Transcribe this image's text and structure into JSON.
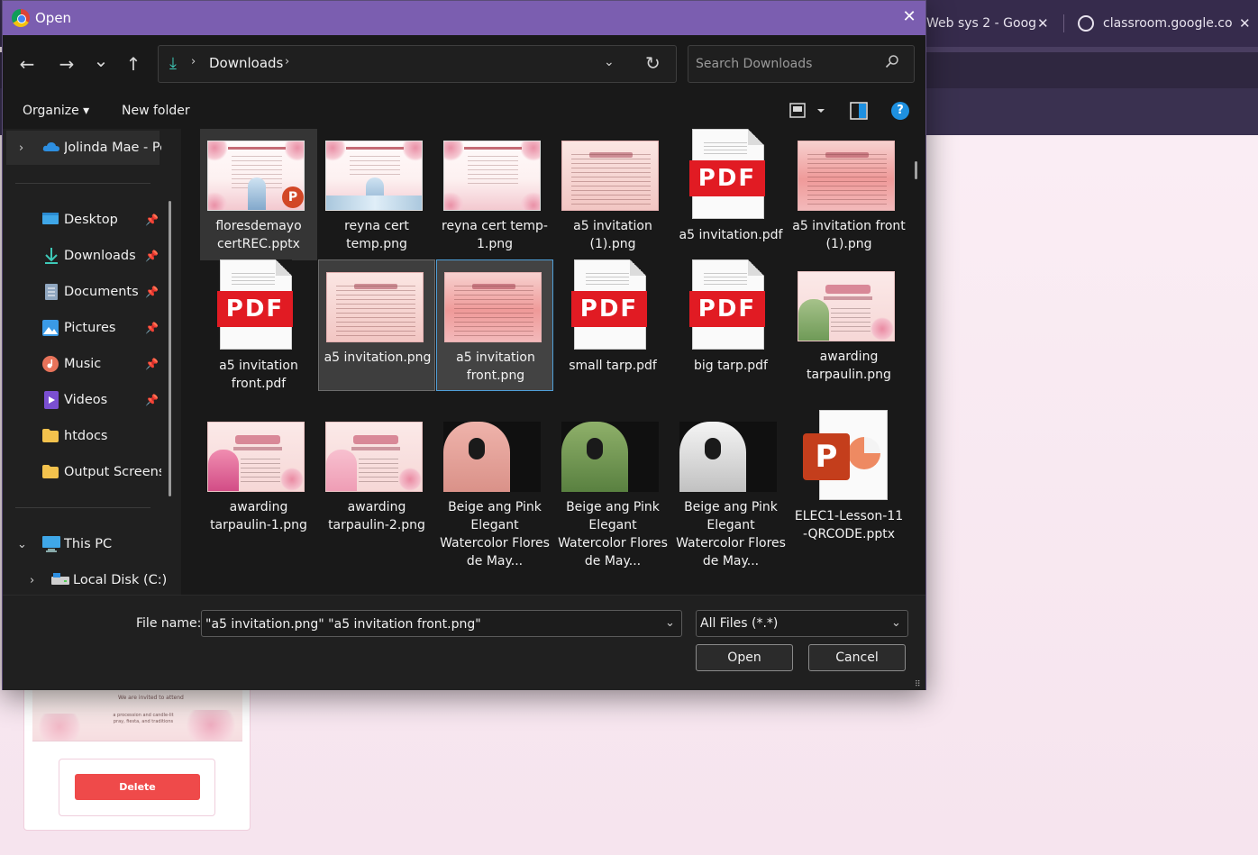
{
  "browser": {
    "tabs": [
      {
        "title": "Web sys 2 - Goog"
      },
      {
        "title": "classroom.google.co"
      }
    ],
    "tab_close_glyph": "✕",
    "card": {
      "delete_label": "Delete",
      "preview_line1": "We are invited to attend",
      "preview_line2": "a procession and candle-lit pray, fiesta, and traditions"
    }
  },
  "dialog": {
    "title": "Open",
    "close_glyph": "✕",
    "nav": {
      "back": "←",
      "forward": "→",
      "recent": "⌄",
      "up": "↑"
    },
    "address": {
      "folder": "Downloads",
      "sep": "›",
      "dropdown": "⌄",
      "refresh": "↻"
    },
    "search": {
      "placeholder": "Search Downloads",
      "icon": "⚲"
    },
    "commands": {
      "organize": "Organize ▾",
      "new_folder": "New folder",
      "help": "?"
    },
    "navpane": {
      "onedrive": "Jolinda Mae - Pe",
      "quick_access": [
        {
          "label": "Desktop",
          "icon": "desktop-icon"
        },
        {
          "label": "Downloads",
          "icon": "download-icon"
        },
        {
          "label": "Documents",
          "icon": "documents-icon"
        },
        {
          "label": "Pictures",
          "icon": "pictures-icon"
        },
        {
          "label": "Music",
          "icon": "music-icon"
        },
        {
          "label": "Videos",
          "icon": "videos-icon"
        },
        {
          "label": "htdocs",
          "icon": "folder-icon"
        },
        {
          "label": "Output Screenshots",
          "icon": "folder-icon"
        }
      ],
      "this_pc": "This PC",
      "local_disk": "Local Disk (C:)",
      "pin_glyph": "📌"
    },
    "files": [
      {
        "name": "floresdemayo certREC.pptx",
        "kind": "cert-ppt",
        "state": "hovered"
      },
      {
        "name": "reyna cert temp.png",
        "kind": "cert",
        "state": ""
      },
      {
        "name": "reyna cert temp-1.png",
        "kind": "cert-plain",
        "state": ""
      },
      {
        "name": "a5 invitation (1).png",
        "kind": "inv-pale",
        "state": ""
      },
      {
        "name": "a5 invitation.pdf",
        "kind": "pdf",
        "state": ""
      },
      {
        "name": "a5 invitation front (1).png",
        "kind": "inv",
        "state": ""
      },
      {
        "name": "a5 invitation front.pdf",
        "kind": "pdf",
        "state": ""
      },
      {
        "name": "a5 invitation.png",
        "kind": "inv-pale",
        "state": "selected"
      },
      {
        "name": "a5 invitation front.png",
        "kind": "inv",
        "state": "focused"
      },
      {
        "name": "small tarp.pdf",
        "kind": "pdf",
        "state": ""
      },
      {
        "name": "big tarp.pdf",
        "kind": "pdf",
        "state": ""
      },
      {
        "name": "awarding tarpaulin.png",
        "kind": "award-green",
        "state": ""
      },
      {
        "name": "awarding tarpaulin-1.png",
        "kind": "award-pink",
        "state": ""
      },
      {
        "name": "awarding tarpaulin-2.png",
        "kind": "award-lightpink",
        "state": ""
      },
      {
        "name": "Beige ang Pink Elegant Watercolor Flores de May...",
        "kind": "veil-pink",
        "state": ""
      },
      {
        "name": "Beige ang Pink Elegant Watercolor Flores de May...",
        "kind": "veil-green",
        "state": ""
      },
      {
        "name": "Beige ang Pink Elegant Watercolor Flores de May...",
        "kind": "veil-white",
        "state": ""
      },
      {
        "name": "ELEC1-Lesson-11 -QRCODE.pptx",
        "kind": "pptx",
        "state": ""
      }
    ],
    "pdf_label": "PDF",
    "ppt_letter": "P",
    "footer": {
      "file_name_label": "File name:",
      "file_name_value": "\"a5 invitation.png\" \"a5 invitation front.png\"",
      "file_type": "All Files (*.*)",
      "open": "Open",
      "cancel": "Cancel",
      "chevron": "⌄"
    }
  },
  "colors": {
    "titlebar": "#7b5eb0",
    "accent_blue": "#1e90e0",
    "pdf_red": "#e11b23",
    "delete_red": "#ef4a4a"
  }
}
